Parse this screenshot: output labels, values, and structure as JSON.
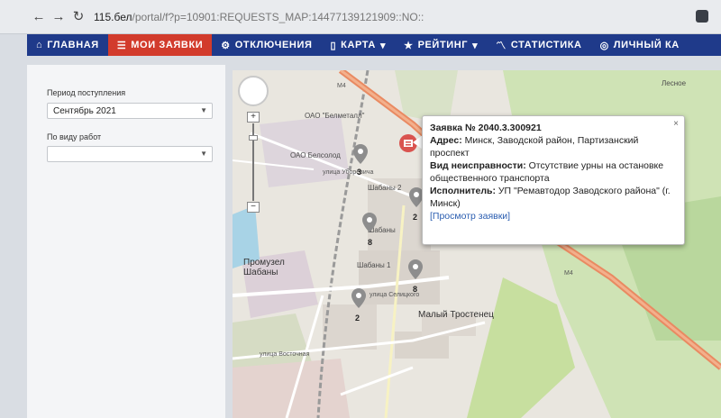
{
  "browser": {
    "url_host": "115.бел",
    "url_path": "/portal/f?p=10901:REQUESTS_MAP:14477139121909::NO::"
  },
  "nav": {
    "items": [
      {
        "label": "ГЛАВНАЯ",
        "icon": "home-icon"
      },
      {
        "label": "МОИ ЗАЯВКИ",
        "icon": "list-icon",
        "active": true
      },
      {
        "label": "ОТКЛЮЧЕНИЯ",
        "icon": "gear-icon"
      },
      {
        "label": "КАРТА",
        "icon": "map-icon",
        "dropdown": true
      },
      {
        "label": "РЕЙТИНГ",
        "icon": "star-icon",
        "dropdown": true
      },
      {
        "label": "СТАТИСТИКА",
        "icon": "chart-icon"
      },
      {
        "label": "ЛИЧНЫЙ КА",
        "icon": "user-icon"
      }
    ],
    "colors": {
      "bar": "#1f3a8a",
      "active": "#d23b2c"
    }
  },
  "filters": {
    "period_label": "Период поступления",
    "period_value": "Сентябрь 2021",
    "work_type_label": "По виду работ",
    "work_type_value": ""
  },
  "map": {
    "labels": {
      "m4_top": "M4",
      "m4_right": "M4",
      "belmetall": "ОАО \"Белметалл\"",
      "belsolod": "ОАО Белсолод",
      "shabany2": "Шабаны 2",
      "shabany": "Шабаны",
      "shabany1": "Шабаны 1",
      "promuzel": "Промузел\nШабаны",
      "maly_trostenets": "Малый Тростенец",
      "selitsky": "улица Селицкого",
      "uborevicha": "улица Уборевича",
      "vostochnaya": "улица Восточная",
      "lesnoe": "Лесное"
    },
    "markers": [
      {
        "count": "3"
      },
      {
        "count": "2"
      },
      {
        "count": "8"
      },
      {
        "count": "8"
      },
      {
        "count": "2"
      }
    ]
  },
  "popup": {
    "title": "Заявка № 2040.3.300921",
    "address_label": "Адрес:",
    "address_value": "Минск, Заводской район, Партизанский проспект",
    "fault_label": "Вид неисправности:",
    "fault_value": "Отсутствие урны на остановке общественного транспорта",
    "executor_label": "Исполнитель:",
    "executor_value": "УП \"Ремавтодор Заводского района\" (г. Минск)",
    "view_link": "[Просмотр заявки]",
    "close": "×"
  }
}
